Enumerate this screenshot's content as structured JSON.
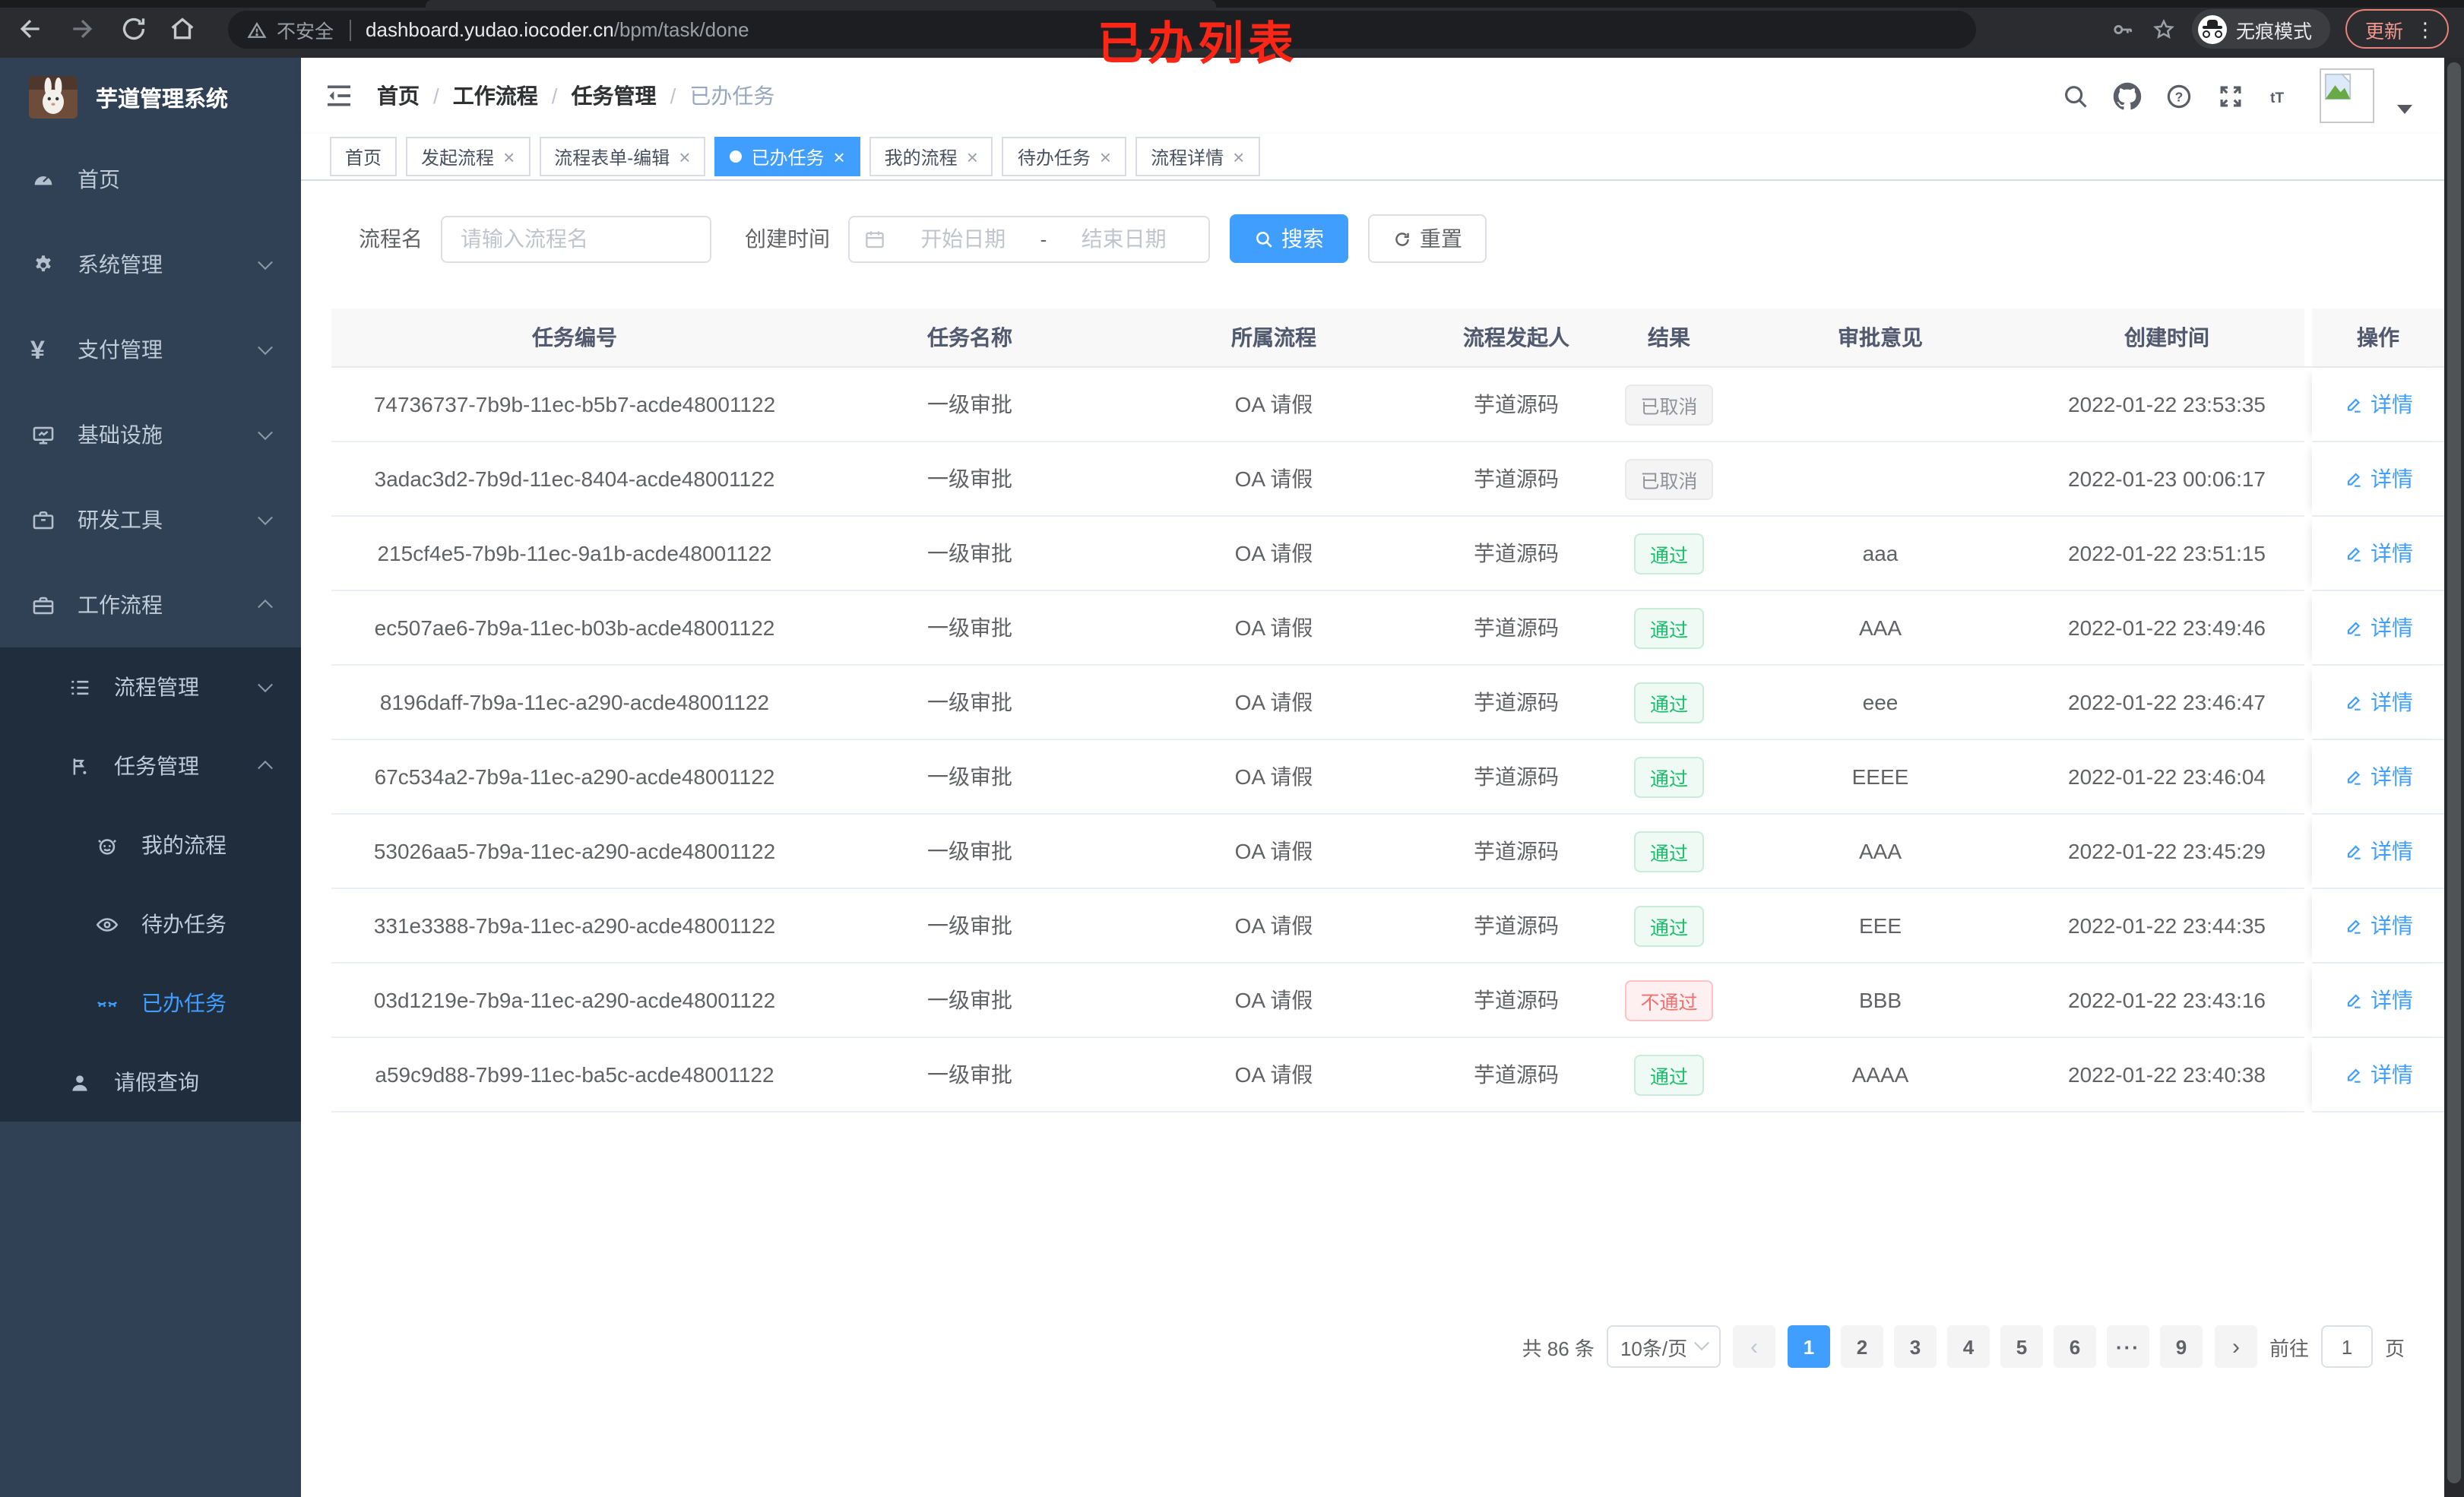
{
  "colors": {
    "accent": "#409eff",
    "success": "#19be6b",
    "danger": "#f56c6c",
    "info": "#909399",
    "sidebar_bg": "#304156",
    "submenu_bg": "#1f2d3d",
    "overlay_red": "#fb2616"
  },
  "browser": {
    "security_label": "不安全",
    "url_host": "dashboard.yudao.iocoder.cn",
    "url_path": "/bpm/task/done",
    "overlay_title": "已办列表",
    "incognito_label": "无痕模式",
    "update_label": "更新",
    "menu_dots": "⋮",
    "icons": [
      "back-icon",
      "forward-icon",
      "reload-icon",
      "home-icon",
      "warning-icon",
      "key-icon",
      "star-icon",
      "incognito-icon"
    ]
  },
  "sidebar": {
    "app_title": "芋道管理系统",
    "menu": [
      {
        "label": "首页",
        "icon": "dashboard-icon"
      },
      {
        "label": "系统管理",
        "icon": "gear-icon"
      },
      {
        "label": "支付管理",
        "icon": "yen-icon"
      },
      {
        "label": "基础设施",
        "icon": "monitor-icon"
      },
      {
        "label": "研发工具",
        "icon": "toolbox-icon"
      },
      {
        "label": "工作流程",
        "icon": "briefcase-icon"
      },
      {
        "label": "流程管理",
        "icon": "list-icon"
      },
      {
        "label": "任务管理",
        "icon": "flow-icon"
      },
      {
        "label": "我的流程",
        "icon": "robot-icon"
      },
      {
        "label": "待办任务",
        "icon": "eye-icon"
      },
      {
        "label": "已办任务",
        "icon": "eye-closed-icon"
      },
      {
        "label": "请假查询",
        "icon": "user-icon"
      }
    ]
  },
  "header": {
    "breadcrumb": [
      "首页",
      "工作流程",
      "任务管理",
      "已办任务"
    ],
    "separator": "/",
    "icons": [
      "hamburger-icon",
      "search-icon",
      "github-icon",
      "help-icon",
      "fullscreen-icon",
      "font-size-icon",
      "avatar",
      "caret-down-icon"
    ],
    "font_size_glyph": "tT"
  },
  "tabs": [
    {
      "label": "首页",
      "cls": "pinned"
    },
    {
      "label": "发起流程",
      "cls": "closable"
    },
    {
      "label": "流程表单-编辑",
      "cls": "closable"
    },
    {
      "label": "已办任务",
      "cls": "active"
    },
    {
      "label": "我的流程",
      "cls": "closable"
    },
    {
      "label": "待办任务",
      "cls": "closable"
    },
    {
      "label": "流程详情",
      "cls": "closable"
    }
  ],
  "search": {
    "name_label": "流程名",
    "name_placeholder": "请输入流程名",
    "name_value": "",
    "time_label": "创建时间",
    "start_placeholder": "开始日期",
    "range_separator": "-",
    "end_placeholder": "结束日期",
    "search_label": "搜索",
    "reset_label": "重置"
  },
  "table": {
    "headers": [
      "任务编号",
      "任务名称",
      "所属流程",
      "流程发起人",
      "结果",
      "审批意见",
      "创建时间",
      "操作"
    ],
    "rows": [
      {
        "id": "74736737-7b9b-11ec-b5b7-acde48001122",
        "name": "一级审批",
        "process": "OA 请假",
        "starter": "芋道源码",
        "result": "已取消",
        "result_type": "info",
        "opinion": "",
        "time": "2022-01-22 23:53:35",
        "action": "详情"
      },
      {
        "id": "3adac3d2-7b9d-11ec-8404-acde48001122",
        "name": "一级审批",
        "process": "OA 请假",
        "starter": "芋道源码",
        "result": "已取消",
        "result_type": "info",
        "opinion": "",
        "time": "2022-01-23 00:06:17",
        "action": "详情"
      },
      {
        "id": "215cf4e5-7b9b-11ec-9a1b-acde48001122",
        "name": "一级审批",
        "process": "OA 请假",
        "starter": "芋道源码",
        "result": "通过",
        "result_type": "success",
        "opinion": "aaa",
        "time": "2022-01-22 23:51:15",
        "action": "详情"
      },
      {
        "id": "ec507ae6-7b9a-11ec-b03b-acde48001122",
        "name": "一级审批",
        "process": "OA 请假",
        "starter": "芋道源码",
        "result": "通过",
        "result_type": "success",
        "opinion": "AAA",
        "time": "2022-01-22 23:49:46",
        "action": "详情"
      },
      {
        "id": "8196daff-7b9a-11ec-a290-acde48001122",
        "name": "一级审批",
        "process": "OA 请假",
        "starter": "芋道源码",
        "result": "通过",
        "result_type": "success",
        "opinion": "eee",
        "time": "2022-01-22 23:46:47",
        "action": "详情"
      },
      {
        "id": "67c534a2-7b9a-11ec-a290-acde48001122",
        "name": "一级审批",
        "process": "OA 请假",
        "starter": "芋道源码",
        "result": "通过",
        "result_type": "success",
        "opinion": "EEEE",
        "time": "2022-01-22 23:46:04",
        "action": "详情"
      },
      {
        "id": "53026aa5-7b9a-11ec-a290-acde48001122",
        "name": "一级审批",
        "process": "OA 请假",
        "starter": "芋道源码",
        "result": "通过",
        "result_type": "success",
        "opinion": "AAA",
        "time": "2022-01-22 23:45:29",
        "action": "详情"
      },
      {
        "id": "331e3388-7b9a-11ec-a290-acde48001122",
        "name": "一级审批",
        "process": "OA 请假",
        "starter": "芋道源码",
        "result": "通过",
        "result_type": "success",
        "opinion": "EEE",
        "time": "2022-01-22 23:44:35",
        "action": "详情"
      },
      {
        "id": "03d1219e-7b9a-11ec-a290-acde48001122",
        "name": "一级审批",
        "process": "OA 请假",
        "starter": "芋道源码",
        "result": "不通过",
        "result_type": "danger",
        "opinion": "BBB",
        "time": "2022-01-22 23:43:16",
        "action": "详情"
      },
      {
        "id": "a59c9d88-7b99-11ec-ba5c-acde48001122",
        "name": "一级审批",
        "process": "OA 请假",
        "starter": "芋道源码",
        "result": "通过",
        "result_type": "success",
        "opinion": "AAAA",
        "time": "2022-01-22 23:40:38",
        "action": "详情"
      }
    ]
  },
  "pager": {
    "total_label": "共 86 条",
    "page_size_label": "10条/页",
    "prev_label": "‹",
    "next_label": "›",
    "pages": [
      {
        "label": "1",
        "cls": "active"
      },
      {
        "label": "2",
        "cls": "num"
      },
      {
        "label": "3",
        "cls": "num"
      },
      {
        "label": "4",
        "cls": "num"
      },
      {
        "label": "5",
        "cls": "num"
      },
      {
        "label": "6",
        "cls": "num"
      },
      {
        "label": "···",
        "cls": "more"
      },
      {
        "label": "9",
        "cls": "num"
      }
    ],
    "goto_label": "前往",
    "goto_value": "1",
    "page_suffix": "页"
  }
}
